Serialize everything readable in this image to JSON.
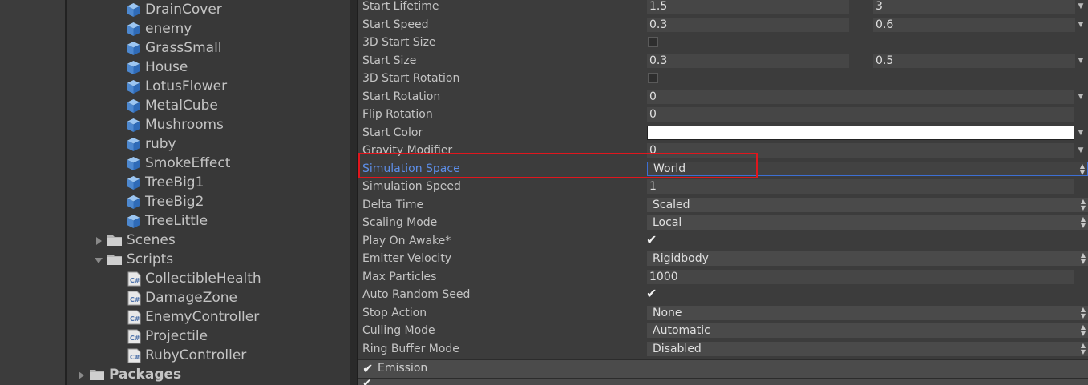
{
  "project": {
    "assets": [
      {
        "label": "DrainCover",
        "type": "prefab"
      },
      {
        "label": "enemy",
        "type": "prefab"
      },
      {
        "label": "GrassSmall",
        "type": "prefab"
      },
      {
        "label": "House",
        "type": "prefab"
      },
      {
        "label": "LotusFlower",
        "type": "prefab"
      },
      {
        "label": "MetalCube",
        "type": "prefab"
      },
      {
        "label": "Mushrooms",
        "type": "prefab"
      },
      {
        "label": "ruby",
        "type": "prefab"
      },
      {
        "label": "SmokeEffect",
        "type": "prefab"
      },
      {
        "label": "TreeBig1",
        "type": "prefab"
      },
      {
        "label": "TreeBig2",
        "type": "prefab"
      },
      {
        "label": "TreeLittle",
        "type": "prefab"
      }
    ],
    "scenes_folder": "Scenes",
    "scripts_folder": "Scripts",
    "scripts": [
      {
        "label": "CollectibleHealth",
        "icon": "csharp-script-icon"
      },
      {
        "label": "DamageZone",
        "icon": "csharp-script-icon"
      },
      {
        "label": "EnemyController",
        "icon": "csharp-script-icon"
      },
      {
        "label": "Projectile",
        "icon": "csharp-script-icon"
      },
      {
        "label": "RubyController",
        "icon": "csharp-script-icon"
      }
    ],
    "packages_folder": "Packages"
  },
  "inspector": {
    "properties": [
      {
        "label": "Start Lifetime",
        "kind": "range",
        "min": "1.5",
        "max": "3"
      },
      {
        "label": "Start Speed",
        "kind": "range",
        "min": "0.3",
        "max": "0.6"
      },
      {
        "label": "3D Start Size",
        "kind": "checkbox",
        "checked": false
      },
      {
        "label": "Start Size",
        "kind": "range",
        "min": "0.3",
        "max": "0.5"
      },
      {
        "label": "3D Start Rotation",
        "kind": "checkbox",
        "checked": false
      },
      {
        "label": "Start Rotation",
        "kind": "value-caret",
        "value": "0"
      },
      {
        "label": "Flip Rotation",
        "kind": "value",
        "value": "0"
      },
      {
        "label": "Start Color",
        "kind": "color",
        "value": "#ffffff"
      },
      {
        "label": "Gravity Modifier",
        "kind": "value-caret",
        "value": "0"
      },
      {
        "label": "Simulation Space",
        "kind": "dropdown",
        "value": "World",
        "focused": true
      },
      {
        "label": "Simulation Speed",
        "kind": "value",
        "value": "1"
      },
      {
        "label": "Delta Time",
        "kind": "dropdown",
        "value": "Scaled"
      },
      {
        "label": "Scaling Mode",
        "kind": "dropdown",
        "value": "Local"
      },
      {
        "label": "Play On Awake*",
        "kind": "checkbox",
        "checked": true
      },
      {
        "label": "Emitter Velocity",
        "kind": "dropdown",
        "value": "Rigidbody"
      },
      {
        "label": "Max Particles",
        "kind": "value",
        "value": "1000"
      },
      {
        "label": "Auto Random Seed",
        "kind": "checkbox",
        "checked": true
      },
      {
        "label": "Stop Action",
        "kind": "dropdown",
        "value": "None"
      },
      {
        "label": "Culling Mode",
        "kind": "dropdown",
        "value": "Automatic"
      },
      {
        "label": "Ring Buffer Mode",
        "kind": "dropdown",
        "value": "Disabled"
      }
    ],
    "emission_module": {
      "label": "Emission",
      "enabled": true
    }
  },
  "colors": {
    "focus_label": "#5d8ee8",
    "highlight_box": "#e0161d",
    "prefab_icon": "#6aa2e2"
  }
}
